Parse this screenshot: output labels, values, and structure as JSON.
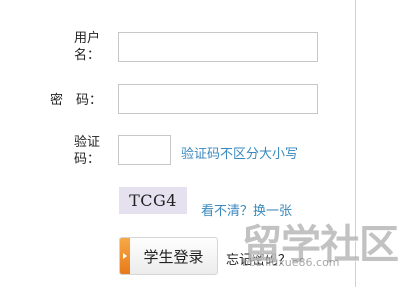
{
  "form": {
    "username_label_line1": "用户",
    "username_label_line2": "名：",
    "username_value": "",
    "password_label": "密　码：",
    "password_value": "",
    "captcha_label_line1": "验证",
    "captcha_label_line2": "码：",
    "captcha_value": "",
    "captcha_hint": "验证码不区分大小写",
    "captcha_image_text": "TCG4",
    "refresh_captcha": "看不清？换一张",
    "login_button": "学生登录",
    "forgot_password": "忘记密码？"
  },
  "watermark": {
    "logo_text": "留学社区",
    "url": "bbs.liuxue86.com"
  },
  "colors": {
    "link": "#3a88bd",
    "button_accent": "#f08a24",
    "border_accent": "#f3c6a9"
  }
}
